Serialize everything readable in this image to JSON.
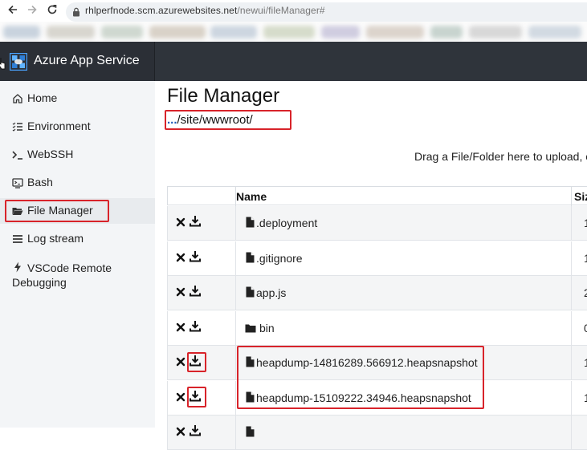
{
  "browser": {
    "url_host": "rhlperfnode.scm.azurewebsites.net",
    "url_path": "/newui/fileManager#"
  },
  "app": {
    "title": "Azure App Service"
  },
  "sidebar": {
    "items": [
      {
        "label": "Home",
        "icon": "home-icon"
      },
      {
        "label": "Environment",
        "icon": "list-icon"
      },
      {
        "label": "WebSSH",
        "icon": "terminal-icon"
      },
      {
        "label": "Bash",
        "icon": "console-icon"
      },
      {
        "label": "File Manager",
        "icon": "folder-open-icon"
      },
      {
        "label": "Log stream",
        "icon": "lines-icon"
      },
      {
        "label": "VSCode Remote",
        "label2": "Debugging",
        "icon": "bolt-icon"
      }
    ]
  },
  "main": {
    "title": "File Manager",
    "breadcrumb_prefix": "...",
    "breadcrumb_path": "/site/wwwroot/",
    "drop_hint": "Drag a File/Folder here to upload, or",
    "columns": {
      "name": "Name",
      "size": "Siz"
    },
    "rows": [
      {
        "name": ".deployment",
        "type": "file",
        "size": "1"
      },
      {
        "name": ".gitignore",
        "type": "file",
        "size": "1"
      },
      {
        "name": "app.js",
        "type": "file",
        "size": "2"
      },
      {
        "name": "bin",
        "type": "folder",
        "size": "0"
      },
      {
        "name": "heapdump-14816289.566912.heapsnapshot",
        "type": "file",
        "size": "1"
      },
      {
        "name": "heapdump-15109222.34946.heapsnapshot",
        "type": "file",
        "size": "1"
      },
      {
        "name": "",
        "type": "file",
        "size": ""
      }
    ]
  },
  "colors": {
    "header_bg": "#2b2f36",
    "sidebar_bg": "#f3f5f7",
    "highlight": "#d8232a",
    "link": "#1d5bb9"
  }
}
